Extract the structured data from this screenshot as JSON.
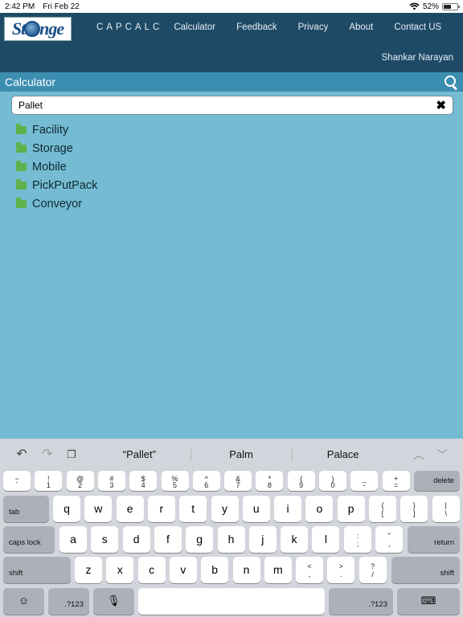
{
  "status_bar": {
    "time": "2:42 PM",
    "date": "Fri Feb 22",
    "battery": "52%",
    "battery_level": 0.52
  },
  "header": {
    "brand": "CAPCALC",
    "logo_text": [
      "St",
      "nge"
    ],
    "nav": [
      "Calculator",
      "Feedback",
      "Privacy",
      "About",
      "Contact US"
    ],
    "user": "Shankar Narayan"
  },
  "calc_bar": {
    "title": "Calculator"
  },
  "search": {
    "value": "Pallet"
  },
  "list": [
    "Facility",
    "Storage",
    "Mobile",
    "PickPutPack",
    "Conveyor"
  ],
  "keyboard": {
    "suggestions": [
      "“Pallet”",
      "Palm",
      "Palace"
    ],
    "num_row": [
      {
        "top": "~",
        "bot": "`"
      },
      {
        "top": "!",
        "bot": "1"
      },
      {
        "top": "@",
        "bot": "2"
      },
      {
        "top": "#",
        "bot": "3"
      },
      {
        "top": "$",
        "bot": "4"
      },
      {
        "top": "%",
        "bot": "5"
      },
      {
        "top": "^",
        "bot": "6"
      },
      {
        "top": "&",
        "bot": "7"
      },
      {
        "top": "*",
        "bot": "8"
      },
      {
        "top": "(",
        "bot": "9"
      },
      {
        "top": ")",
        "bot": "0"
      },
      {
        "top": "_",
        "bot": "-"
      },
      {
        "top": "+",
        "bot": "="
      }
    ],
    "row1": [
      "q",
      "w",
      "e",
      "r",
      "t",
      "y",
      "u",
      "i",
      "o",
      "p"
    ],
    "row1_extra": [
      {
        "top": "{",
        "bot": "["
      },
      {
        "top": "}",
        "bot": "]"
      },
      {
        "top": "|",
        "bot": "\\"
      }
    ],
    "row2": [
      "a",
      "s",
      "d",
      "f",
      "g",
      "h",
      "j",
      "k",
      "l"
    ],
    "row2_extra": [
      {
        "top": ":",
        "bot": ";"
      },
      {
        "top": "\"",
        "bot": ","
      }
    ],
    "row3": [
      "z",
      "x",
      "c",
      "v",
      "b",
      "n",
      "m"
    ],
    "row3_extra": [
      {
        "top": "<",
        "bot": ","
      },
      {
        "top": ">",
        "bot": "."
      },
      {
        "top": "?",
        "bot": "/"
      }
    ],
    "labels": {
      "delete": "delete",
      "tab": "tab",
      "caps": "caps lock",
      "return": "return",
      "shift": "shift",
      "num": ".?123"
    }
  }
}
